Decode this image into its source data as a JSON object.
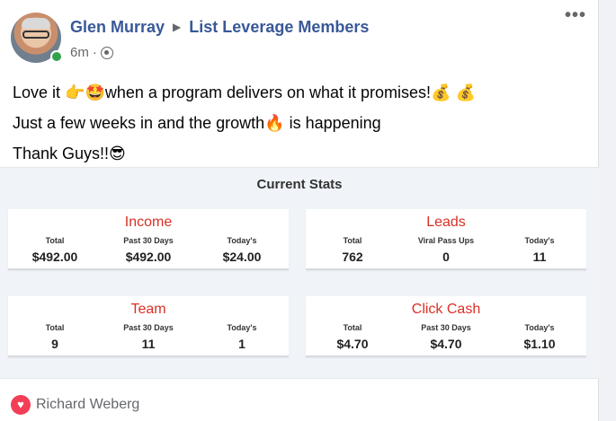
{
  "post": {
    "author": "Glen Murray",
    "group": "List Leverage Members",
    "time": "6m",
    "more_icon": "more-options-icon",
    "lines": [
      {
        "text1": "Love it ",
        "emoji1": "👉",
        "emoji2": "🤩",
        "text2": "when a program delivers on what it promises!",
        "emoji3": "💰",
        "emoji4": "💰"
      },
      {
        "text1": "Just a few weeks in and the growth",
        "emoji1": "🔥",
        "text2": " is happening"
      },
      {
        "text1": "Thank Guys!!",
        "emoji1": "😎"
      }
    ]
  },
  "stats": {
    "title": "Current Stats",
    "cards": [
      {
        "title": "Income",
        "cols": [
          {
            "label": "Total",
            "value": "$492.00"
          },
          {
            "label": "Past 30 Days",
            "value": "$492.00"
          },
          {
            "label": "Today's",
            "value": "$24.00"
          }
        ]
      },
      {
        "title": "Leads",
        "cols": [
          {
            "label": "Total",
            "value": "762"
          },
          {
            "label": "Viral Pass Ups",
            "value": "0"
          },
          {
            "label": "Today's",
            "value": "11"
          }
        ]
      },
      {
        "title": "Team",
        "cols": [
          {
            "label": "Total",
            "value": "9"
          },
          {
            "label": "Past 30 Days",
            "value": "11"
          },
          {
            "label": "Today's",
            "value": "1"
          }
        ]
      },
      {
        "title": "Click Cash",
        "cols": [
          {
            "label": "Total",
            "value": "$4.70"
          },
          {
            "label": "Past 30 Days",
            "value": "$4.70"
          },
          {
            "label": "Today's",
            "value": "$1.10"
          }
        ]
      }
    ]
  },
  "reactions": {
    "icon": "love-reaction-icon",
    "name": "Richard Weberg"
  },
  "colors": {
    "link": "#385898",
    "accent_red": "#d93025",
    "online": "#31a24c",
    "love": "#f33e58"
  }
}
